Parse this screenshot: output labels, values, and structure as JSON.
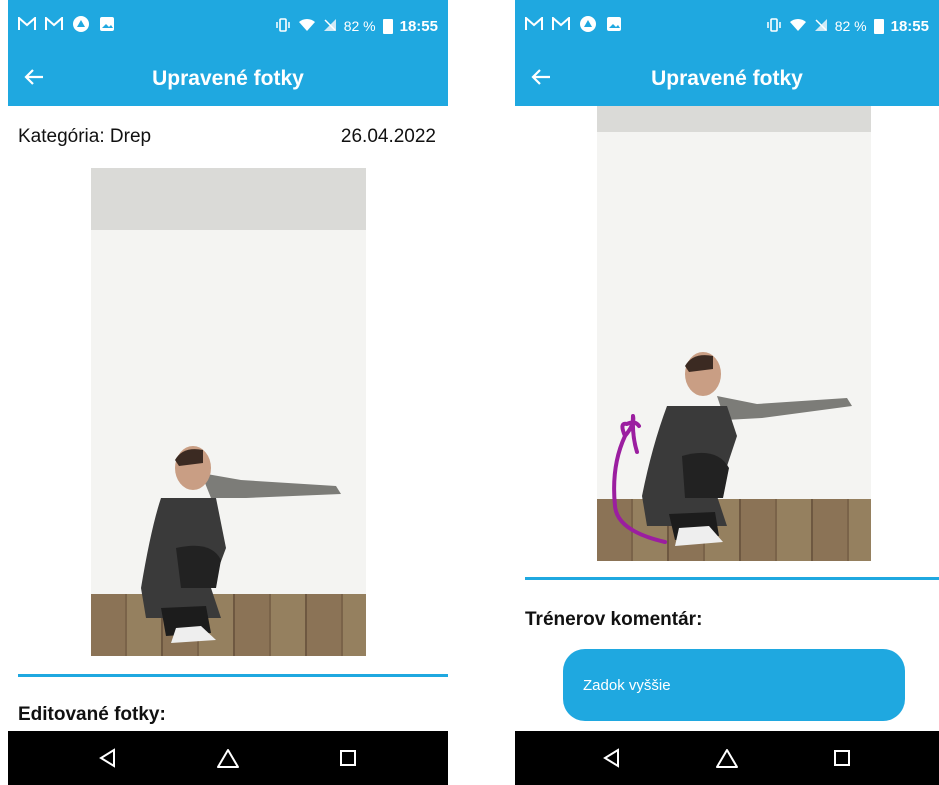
{
  "statusbar": {
    "left_icons": [
      "gmail-icon",
      "gmail-icon",
      "app-icon",
      "image-icon"
    ],
    "battery": "82 %",
    "time": "18:55"
  },
  "left_screen": {
    "title": "Upravené fotky",
    "category": "Kategória: Drep",
    "date": "26.04.2022",
    "edited_heading": "Editované fotky:"
  },
  "right_screen": {
    "title": "Upravené fotky",
    "comment_heading": "Trénerov komentár:",
    "comment_text": "Zadok vyššie"
  },
  "colors": {
    "accent": "#1fa8e0",
    "annotation": "#9b1ea0",
    "navbar": "#000000"
  },
  "navbar": [
    "back-triangle-icon",
    "home-circle-icon",
    "recents-square-icon"
  ]
}
